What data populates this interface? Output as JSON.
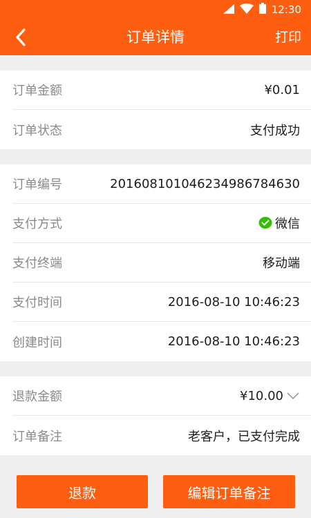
{
  "status_bar": {
    "time": "12:30"
  },
  "header": {
    "title": "订单详情",
    "print_label": "打印"
  },
  "group1": [
    {
      "label": "订单金额",
      "value": "¥0.01"
    },
    {
      "label": "订单状态",
      "value": "支付成功"
    }
  ],
  "group2": [
    {
      "label": "订单编号",
      "value": "2016081010462349867846​30"
    },
    {
      "label": "支付方式",
      "value": "微信"
    },
    {
      "label": "支付终端",
      "value": "移动端"
    },
    {
      "label": "支付时间",
      "value": "2016-08-10 10:46:23"
    },
    {
      "label": "创建时间",
      "value": "2016-08-10 10:46:23"
    }
  ],
  "group3": [
    {
      "label": "退款金额",
      "value": "¥10.00"
    },
    {
      "label": "订单备注",
      "value": "老客户，已支付完成"
    }
  ],
  "footer": {
    "refund_label": "退款",
    "edit_note_label": "编辑订单备注"
  },
  "colors": {
    "accent": "#fe5e10",
    "wechat_green": "#2dc100"
  }
}
